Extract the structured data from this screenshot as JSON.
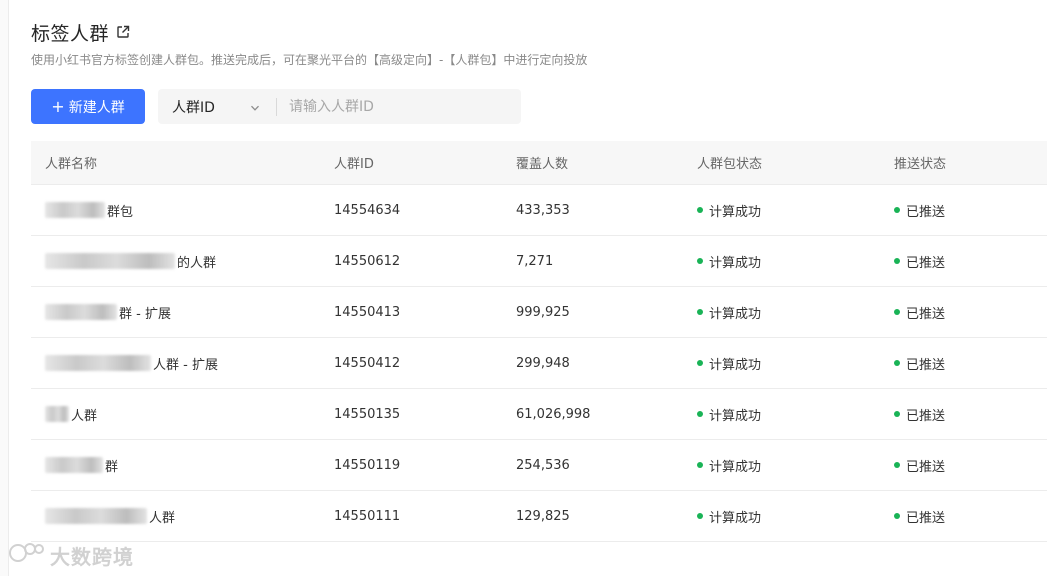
{
  "header": {
    "title": "标签人群",
    "description": "使用小红书官方标签创建人群包。推送完成后，可在聚光平台的【高级定向】-【人群包】中进行定向投放"
  },
  "toolbar": {
    "new_button_label": "新建人群",
    "filter_select_value": "人群ID",
    "search_placeholder": "请输入人群ID"
  },
  "table": {
    "columns": [
      "人群名称",
      "人群ID",
      "覆盖人数",
      "人群包状态",
      "推送状态"
    ],
    "rows": [
      {
        "name": "群包",
        "id": "14554634",
        "coverage": "433,353",
        "pack_status": "计算成功",
        "push_status": "已推送"
      },
      {
        "name": "的人群",
        "id": "14550612",
        "coverage": "7,271",
        "pack_status": "计算成功",
        "push_status": "已推送"
      },
      {
        "name": "群 - 扩展",
        "id": "14550413",
        "coverage": "999,925",
        "pack_status": "计算成功",
        "push_status": "已推送"
      },
      {
        "name": "人群 - 扩展",
        "id": "14550412",
        "coverage": "299,948",
        "pack_status": "计算成功",
        "push_status": "已推送"
      },
      {
        "name": "人群",
        "id": "14550135",
        "coverage": "61,026,998",
        "pack_status": "计算成功",
        "push_status": "已推送"
      },
      {
        "name": "群",
        "id": "14550119",
        "coverage": "254,536",
        "pack_status": "计算成功",
        "push_status": "已推送"
      },
      {
        "name": "人群",
        "id": "14550111",
        "coverage": "129,825",
        "pack_status": "计算成功",
        "push_status": "已推送"
      }
    ]
  },
  "watermark": {
    "text": "大数跨境"
  },
  "colors": {
    "primary": "#3d74ff",
    "success_dot": "#19b356",
    "header_bg": "#f7f7f7"
  },
  "icons": {
    "title_link": "external-link-icon",
    "select_chevron": "chevron-down-icon",
    "new_button": "plus-icon",
    "status_dot": "dot-icon"
  }
}
